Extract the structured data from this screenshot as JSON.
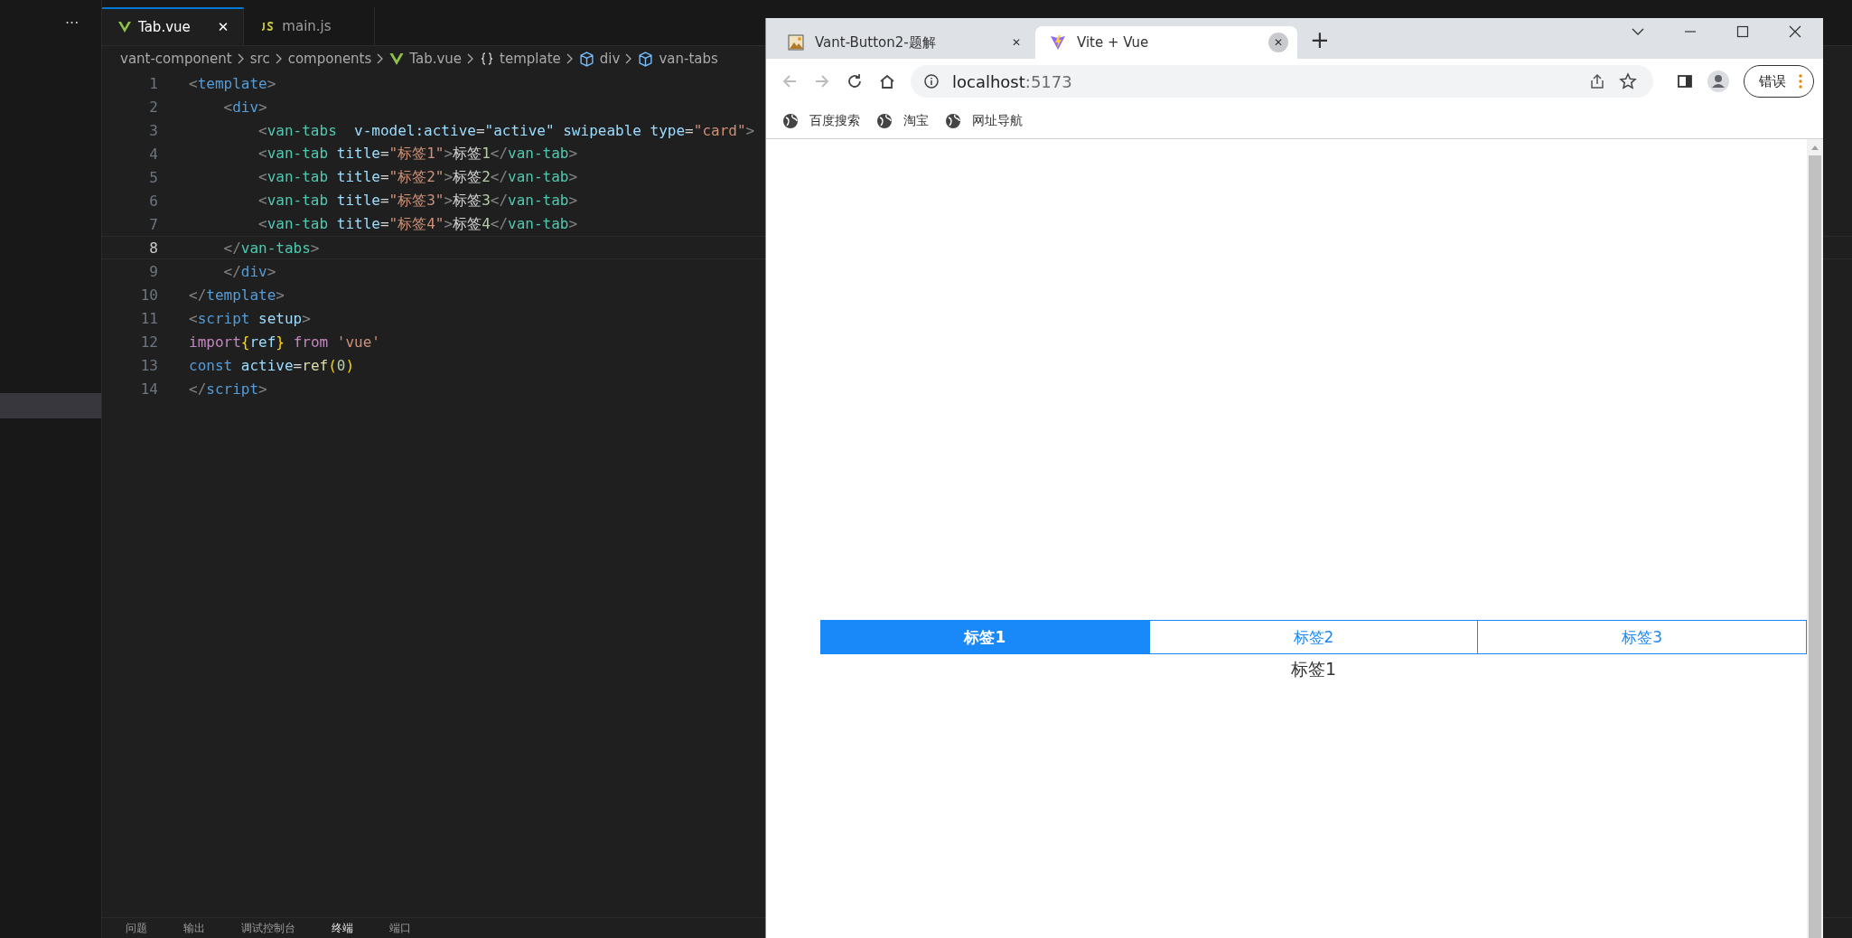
{
  "editor": {
    "more": "···",
    "tabs": [
      {
        "label": "Tab.vue",
        "kind": "vue",
        "selected": true,
        "close": "✕"
      },
      {
        "label": "main.js",
        "kind": "js",
        "selected": false
      }
    ],
    "breadcrumb": [
      {
        "label": "vant-component",
        "kind": "folder"
      },
      {
        "label": "src",
        "kind": "folder"
      },
      {
        "label": "components",
        "kind": "folder"
      },
      {
        "label": "Tab.vue",
        "kind": "file"
      },
      {
        "label": "template",
        "kind": "block"
      },
      {
        "label": "div",
        "kind": "element"
      },
      {
        "label": "van-tabs",
        "kind": "element"
      }
    ],
    "lines": [
      {
        "number": "1",
        "current": false,
        "code": "<template>"
      },
      {
        "number": "2",
        "current": false,
        "code": "    <div>"
      },
      {
        "number": "3",
        "current": false,
        "code": "        <van-tabs  v-model:active=\"active\" swipeable type=\"card\">"
      },
      {
        "number": "4",
        "current": false,
        "code": "        <van-tab title=\"标签1\">标签1</van-tab>"
      },
      {
        "number": "5",
        "current": false,
        "code": "        <van-tab title=\"标签2\">标签2</van-tab>"
      },
      {
        "number": "6",
        "current": false,
        "code": "        <van-tab title=\"标签3\">标签3</van-tab>"
      },
      {
        "number": "7",
        "current": false,
        "code": "        <van-tab title=\"标签4\">标签4</van-tab>"
      },
      {
        "number": "8",
        "current": true,
        "code": "    </van-tabs>"
      },
      {
        "number": "9",
        "current": false,
        "code": "    </div>"
      },
      {
        "number": "10",
        "current": false,
        "code": "</template>"
      },
      {
        "number": "11",
        "current": false,
        "code": "<script setup>"
      },
      {
        "number": "12",
        "current": false,
        "code": "import{ref} from 'vue'"
      },
      {
        "number": "13",
        "current": false,
        "code": "const active=ref(0)"
      },
      {
        "number": "14",
        "current": false,
        "code": "</script>"
      }
    ],
    "panel_tabs": [
      {
        "label": "问题",
        "selected": false
      },
      {
        "label": "输出",
        "selected": false
      },
      {
        "label": "调试控制台",
        "selected": false
      },
      {
        "label": "终端",
        "selected": true
      },
      {
        "label": "端口",
        "selected": false
      }
    ]
  },
  "browser": {
    "tabs": [
      {
        "title": "Vant-Button2-题解",
        "selected": false,
        "close": "✕"
      },
      {
        "title": "Vite + Vue",
        "selected": true,
        "close": "✕"
      }
    ],
    "new_tab": "+",
    "address": {
      "host": "localhost",
      "port": ":5173"
    },
    "profile_button": "错误",
    "bookmarks": [
      "百度搜索",
      "淘宝",
      "网址导航"
    ],
    "page": {
      "tabs": [
        {
          "title": "标签1",
          "selected": true
        },
        {
          "title": "标签2",
          "selected": false
        },
        {
          "title": "标签3",
          "selected": false
        }
      ],
      "content": "标签1"
    }
  }
}
